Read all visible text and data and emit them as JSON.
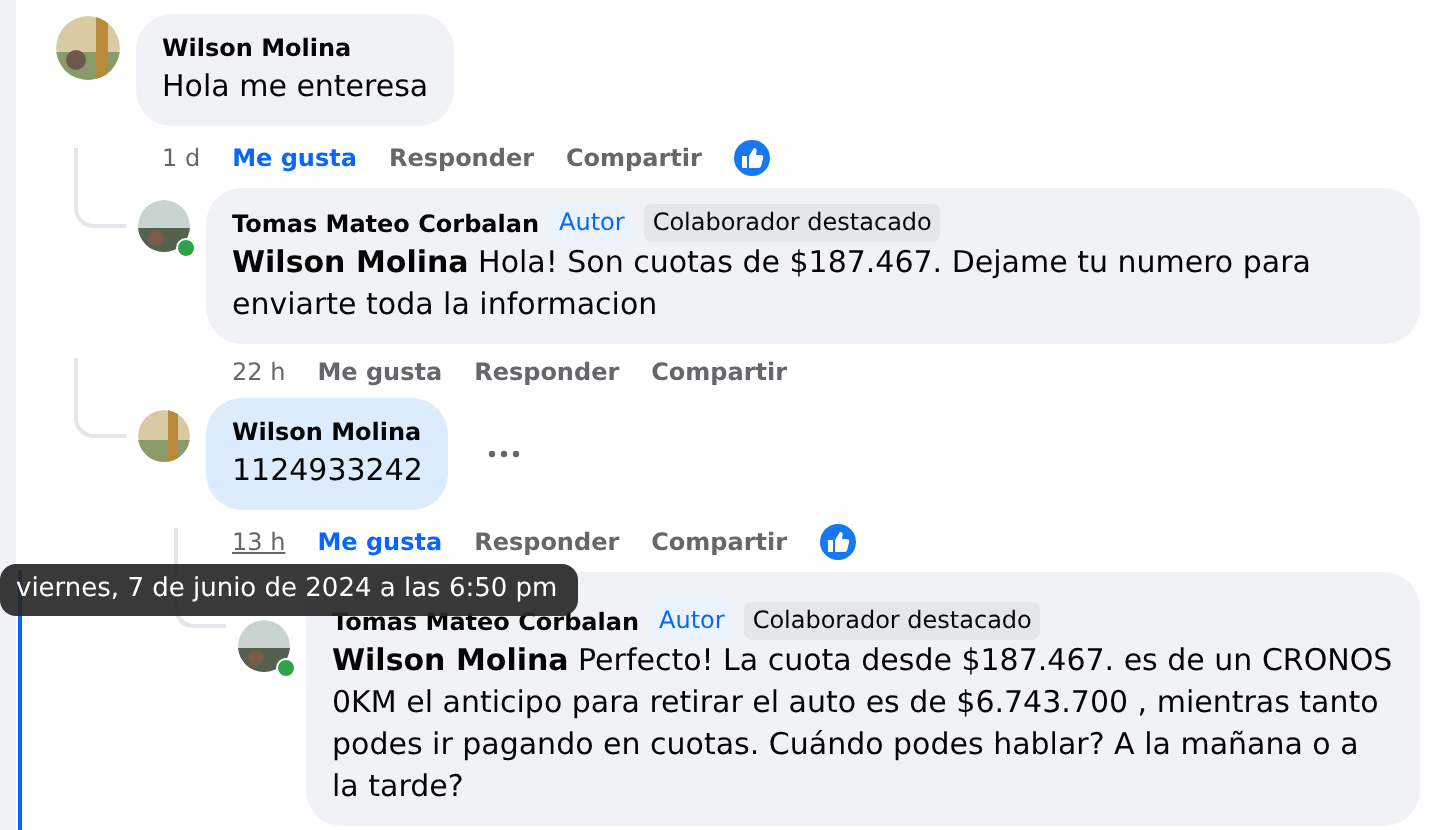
{
  "comments": [
    {
      "author": "Wilson Molina",
      "text": "Hola me enteresa",
      "time": "1 d",
      "time_underlined": false,
      "actions": [
        {
          "label": "Me gusta",
          "selected": true
        },
        {
          "label": "Responder",
          "selected": false
        },
        {
          "label": "Compartir",
          "selected": false
        }
      ],
      "reaction": true,
      "replies": [
        {
          "author": "Tomas Mateo Corbalan",
          "badges": [
            {
              "label": "Autor",
              "kind": "author"
            },
            {
              "label": "Colaborador destacado",
              "kind": "contributor"
            }
          ],
          "online": true,
          "mention": "Wilson Molina",
          "text": "Hola! Son cuotas de $187.467. Dejame tu numero para enviarte toda la informacion",
          "time": "22 h",
          "time_underlined": false,
          "actions": [
            {
              "label": "Me gusta",
              "selected": false
            },
            {
              "label": "Responder",
              "selected": false
            },
            {
              "label": "Compartir",
              "selected": false
            }
          ],
          "reaction": false
        },
        {
          "author": "Wilson Molina",
          "text": "1124933242",
          "highlighted": true,
          "more_menu": true,
          "time": "13 h",
          "time_underlined": true,
          "actions": [
            {
              "label": "Me gusta",
              "selected": true
            },
            {
              "label": "Responder",
              "selected": false
            },
            {
              "label": "Compartir",
              "selected": false
            }
          ],
          "reaction": true,
          "replies": [
            {
              "author": "Tomas Mateo Corbalan",
              "badges": [
                {
                  "label": "Autor",
                  "kind": "author"
                },
                {
                  "label": "Colaborador destacado",
                  "kind": "contributor"
                }
              ],
              "online": true,
              "mention": "Wilson Molina",
              "text": "Perfecto! La cuota desde $187.467. es de un CRONOS 0KM el anticipo para retirar el auto es de $6.743.700 , mientras tanto podes ir pagando en cuotas. Cuándo podes hablar? A la mañana o a la tarde?"
            }
          ]
        }
      ]
    }
  ],
  "tooltip": {
    "text": "viernes, 7 de junio de 2024 a las 6:50 pm"
  }
}
